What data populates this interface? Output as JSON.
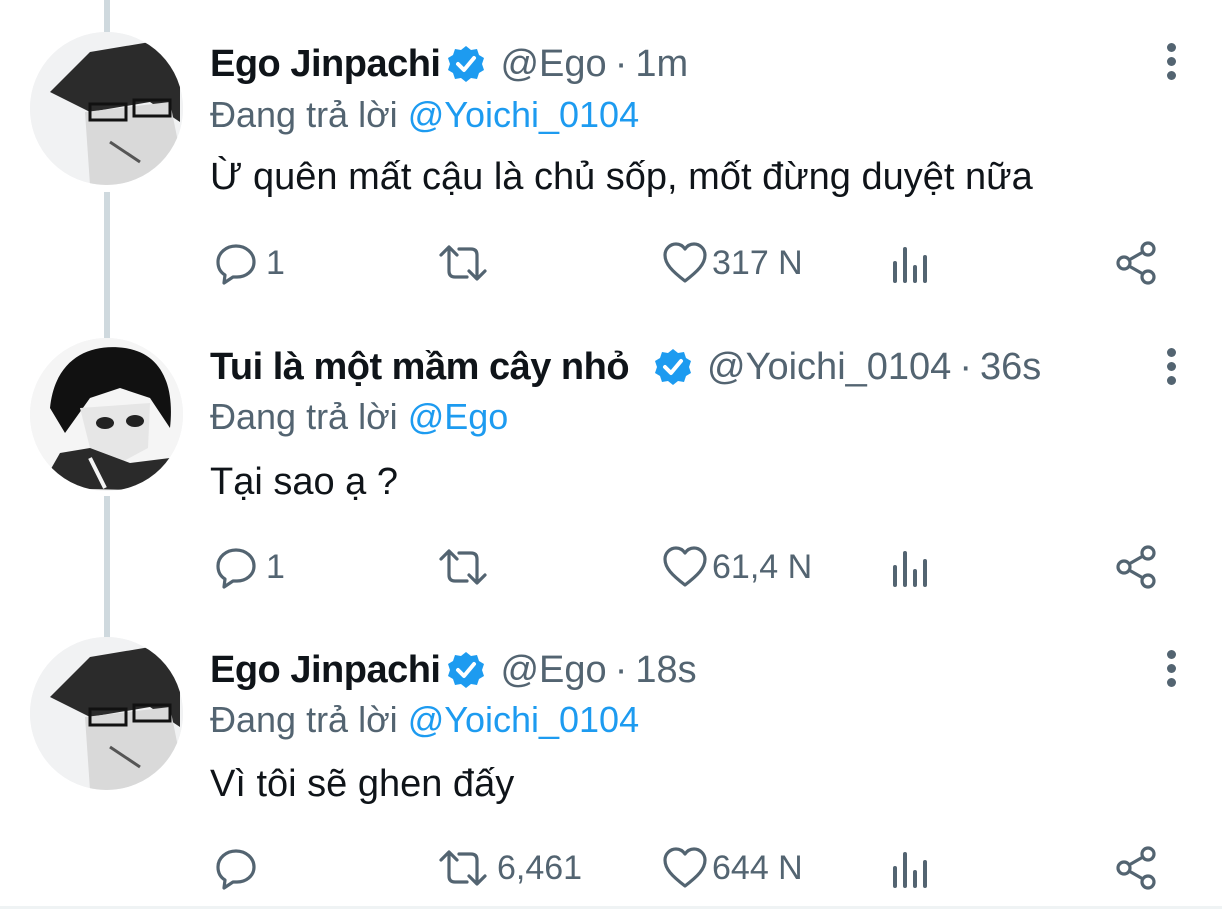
{
  "tweets": [
    {
      "display_name": "Ego Jinpachi",
      "handle": "@Ego",
      "separator": "·",
      "time": "1m",
      "reply_prefix": "Đang trả lời",
      "reply_to": "@Yoichi_0104",
      "text": "Ừ quên mất cậu là chủ sốp, mốt đừng duyệt nữa",
      "replies": "1",
      "retweets": "",
      "likes": "317 N"
    },
    {
      "display_name": "Tui là một mầm cây nhỏ",
      "handle": "@Yoichi_0104",
      "separator": "·",
      "time": "36s",
      "reply_prefix": "Đang trả lời",
      "reply_to": "@Ego",
      "text": "Tại sao ạ ?",
      "replies": "1",
      "retweets": "",
      "likes": "61,4 N"
    },
    {
      "display_name": "Ego Jinpachi",
      "handle": "@Ego",
      "separator": "·",
      "time": "18s",
      "reply_prefix": "Đang trả lời",
      "reply_to": "@Yoichi_0104",
      "text": "Vì tôi sẽ ghen đấy",
      "replies": "",
      "retweets": "6,461",
      "likes": "644 N"
    }
  ],
  "icons": {
    "verified": "verified-badge-icon",
    "more": "more-vertical-icon",
    "reply": "reply-icon",
    "retweet": "retweet-icon",
    "like": "heart-icon",
    "views": "views-icon",
    "share": "share-icon"
  },
  "colors": {
    "accent": "#1d9bf0",
    "muted": "#536471",
    "text": "#0f1419",
    "thread_line": "#cfd9de"
  }
}
